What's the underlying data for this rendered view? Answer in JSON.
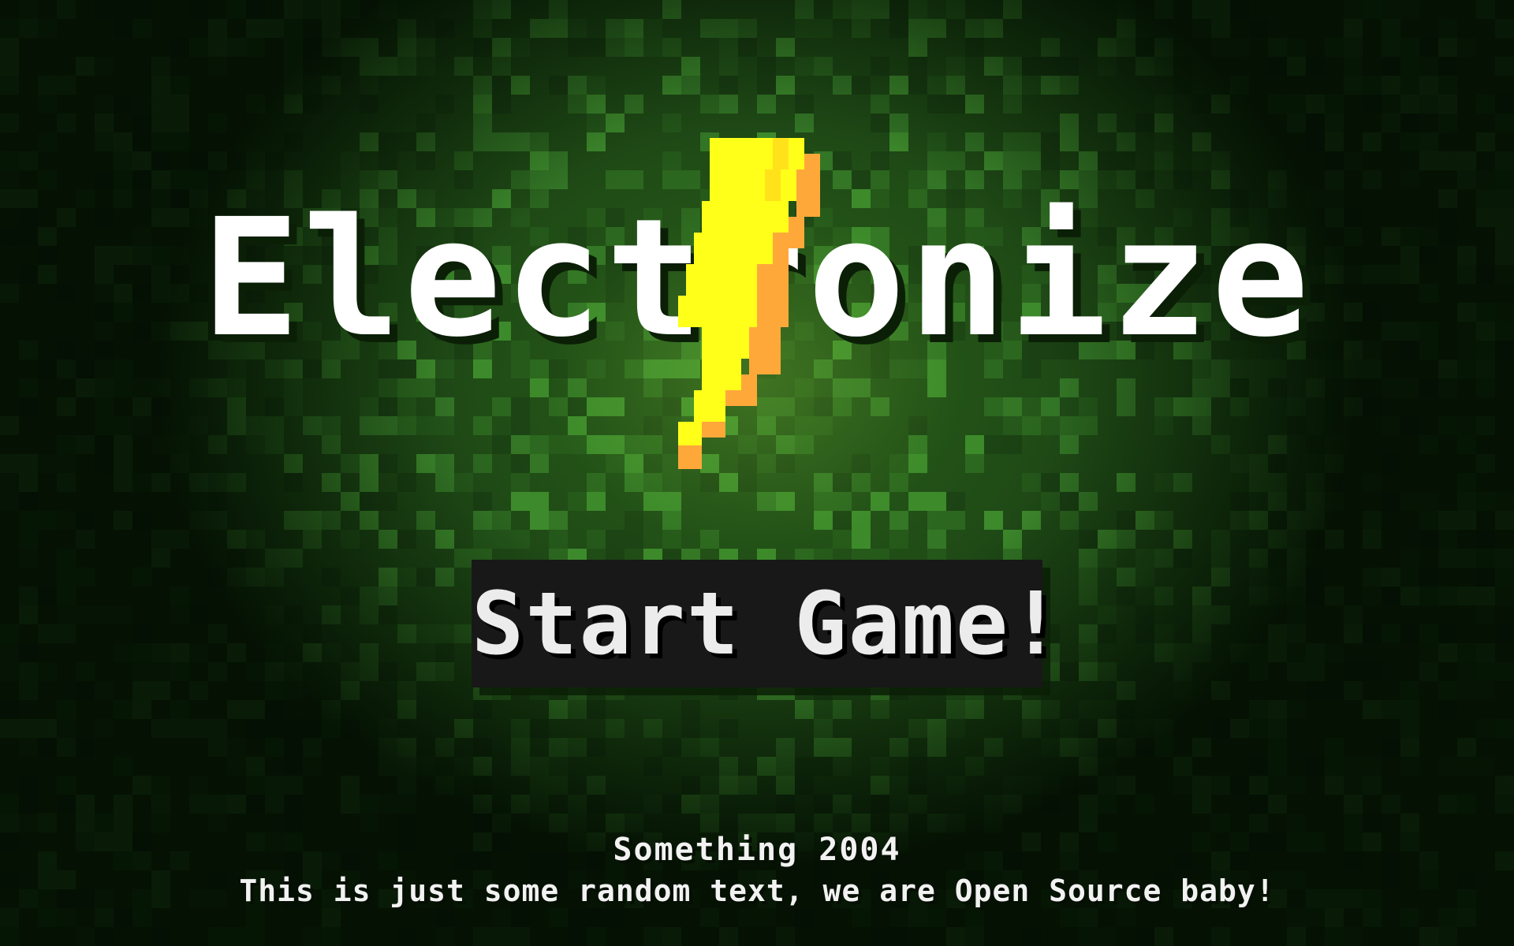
{
  "title": {
    "text": "Electronize"
  },
  "menu": {
    "start_label": "Start Game!"
  },
  "footer": {
    "line1": "Something 2004",
    "line2": "This is just some random text, we are Open Source baby!"
  },
  "icons": {
    "logo": "lightning-bolt-icon"
  },
  "colors": {
    "background": "#1f4a16",
    "pattern_light": "#3a8a2a",
    "title": "#ffffff",
    "bolt_main": "#ffff1a",
    "bolt_shade": "#ffa83a",
    "button_bg": "#181818",
    "button_text": "#ececec"
  }
}
